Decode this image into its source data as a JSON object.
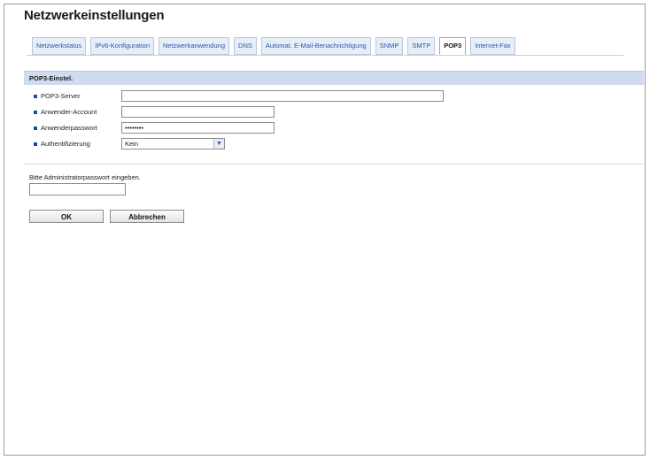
{
  "page": {
    "title": "Netzwerkeinstellungen"
  },
  "tabs": [
    {
      "label": "Netzwerkstatus",
      "active": false
    },
    {
      "label": "IPv6-Konfiguration",
      "active": false
    },
    {
      "label": "Netzwerkanwendung",
      "active": false
    },
    {
      "label": "DNS",
      "active": false
    },
    {
      "label": "Automat. E-Mail-Benachrichtigung",
      "active": false
    },
    {
      "label": "SNMP",
      "active": false
    },
    {
      "label": "SMTP",
      "active": false
    },
    {
      "label": "POP3",
      "active": true
    },
    {
      "label": "Internet-Fax",
      "active": false
    }
  ],
  "section": {
    "title": "POP3-Einstel."
  },
  "form": {
    "server_label": "POP3-Server",
    "server_value": "",
    "account_label": "Anwender-Account",
    "account_value": "",
    "password_label": "Anwenderpasswort",
    "password_value": "••••••••",
    "auth_label": "Authentifizierung",
    "auth_value": "Kein"
  },
  "admin": {
    "prompt": "Bitte Administratorpasswort eingeben.",
    "password_value": ""
  },
  "buttons": {
    "ok_label": "OK",
    "cancel_label": "Abbrechen"
  },
  "colors": {
    "tab_text": "#2a57a8",
    "section_header_bg": "#cfdcef",
    "bullet": "#1f4aa8"
  },
  "icons": {
    "bullet": "square-bullet-icon",
    "select_arrow": "chevron-down-icon"
  }
}
